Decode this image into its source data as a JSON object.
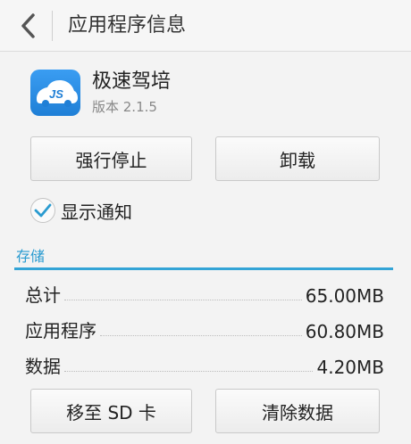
{
  "header": {
    "title": "应用程序信息",
    "back_icon": "chevron-left-icon"
  },
  "app": {
    "icon_text": "JS",
    "name": "极速驾培",
    "version": "版本 2.1.5"
  },
  "actions": {
    "force_stop": "强行停止",
    "uninstall": "卸载"
  },
  "notification": {
    "label": "显示通知",
    "checked": true
  },
  "storage": {
    "title": "存储",
    "rows": [
      {
        "label": "总计",
        "value": "65.00MB"
      },
      {
        "label": "应用程序",
        "value": "60.80MB"
      },
      {
        "label": "数据",
        "value": "4.20MB"
      }
    ],
    "move_to_sd": "移至 SD 卡",
    "clear_data": "清除数据"
  },
  "colors": {
    "accent": "#33a4d6",
    "app_icon": "#2a8ae4"
  }
}
